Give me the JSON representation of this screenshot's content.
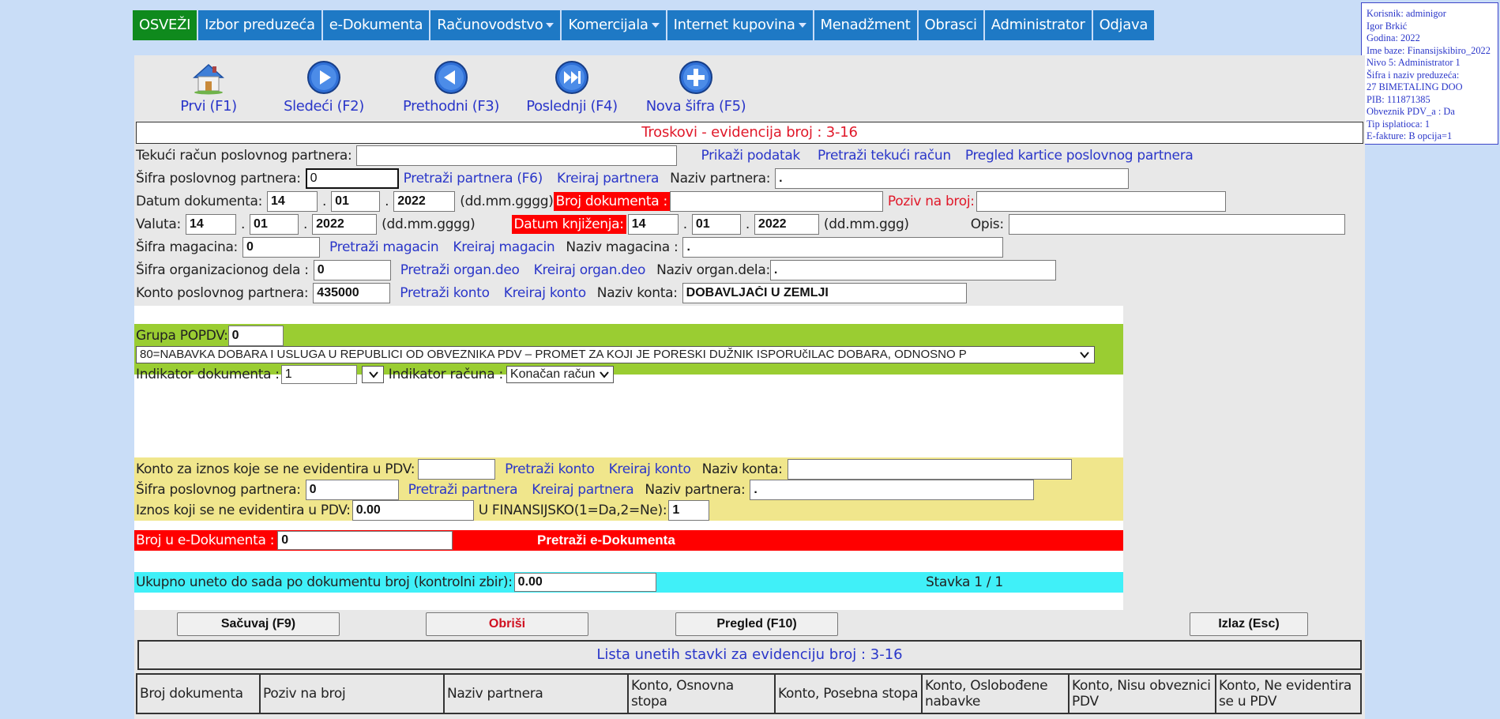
{
  "nav": {
    "items": [
      {
        "label": "OSVEŽI",
        "dropdown": false
      },
      {
        "label": "Izbor preduzeća",
        "dropdown": false
      },
      {
        "label": "e-Dokumenta",
        "dropdown": false
      },
      {
        "label": "Računovodstvo",
        "dropdown": true
      },
      {
        "label": "Komercijala",
        "dropdown": true
      },
      {
        "label": "Internet kupovina",
        "dropdown": true
      },
      {
        "label": "Menadžment",
        "dropdown": false
      },
      {
        "label": "Obrasci",
        "dropdown": false
      },
      {
        "label": "Administrator",
        "dropdown": false
      },
      {
        "label": "Odjava",
        "dropdown": false
      }
    ]
  },
  "user_info": {
    "lines": [
      "Korisnik: adminigor",
      "Igor Brkić",
      "Godina: 2022",
      "Ime baze: Finansijskibiro_2022",
      "Nivo 5: Administrator 1",
      "Šifra i naziv preduzeća:",
      "27 BIMETALING DOO",
      "PIB: 111871385",
      "Obveznik PDV_a : Da",
      "Tip isplatioca: 1",
      "E-fakture: B opcija=1"
    ]
  },
  "toolbar": {
    "first": "Prvi (F1)",
    "next": "Sledeći (F2)",
    "prev": "Prethodni (F3)",
    "last": "Poslednji (F4)",
    "new": "Nova šifra (F5)"
  },
  "colors": {
    "nav_blue": "#1e79c5",
    "nav_green": "#0f8a1d",
    "title_red": "#e0192a",
    "link_blue": "#2a36c9"
  },
  "doc_title": "Troskovi - evidencija broj : 3-16",
  "form": {
    "tekuci_racun_label": "Tekući račun poslovnog partnera:",
    "tekuci_racun_value": "",
    "prikazi_podatak": "Prikaži podatak",
    "pretrazi_tekuci": "Pretraži tekući račun",
    "pregled_kartice": "Pregled kartice poslovnog partnera",
    "sifra_partnera_label": "Šifra poslovnog partnera:",
    "sifra_partnera_value": "0",
    "pretrazi_partnera": "Pretraži partnera (F6)",
    "kreiraj_partnera": "Kreiraj partnera",
    "naziv_partnera_label": "Naziv partnera:",
    "naziv_partnera_value": ".",
    "datum_dok_label": "Datum dokumenta:",
    "datum_dok_d": "14",
    "datum_dok_m": "01",
    "datum_dok_y": "2022",
    "fmt_long": "(dd.mm.gggg)",
    "fmt_short": "(dd.mm.ggg)",
    "dot": ".",
    "broj_dok_label": "Broj dokumenta :",
    "broj_dok_value": "",
    "poziv_label": "Poziv na broj:",
    "poziv_value": "",
    "valuta_label": "Valuta:",
    "valuta_d": "14",
    "valuta_m": "01",
    "valuta_y": "2022",
    "datum_knj_label": "Datum knjiženja:",
    "knj_d": "14",
    "knj_m": "01",
    "knj_y": "2022",
    "opis_label": "Opis:",
    "opis_value": "",
    "sifra_magacina_label": "Šifra magacina:",
    "sifra_magacina_value": "0",
    "pretrazi_magacin": "Pretraži magacin",
    "kreiraj_magacin": "Kreiraj magacin",
    "naziv_magacina_label": "Naziv magacina :",
    "naziv_magacina_value": ".",
    "sifra_org_label": "Šifra organizacionog dela :",
    "sifra_org_value": "0",
    "pretrazi_org": "Pretraži organ.deo",
    "kreiraj_org": "Kreiraj organ.deo",
    "naziv_org_label": "Naziv organ.dela:",
    "naziv_org_value": ".",
    "konto_partnera_label": "Konto poslovnog partnera:",
    "konto_partnera_value": "435000",
    "pretrazi_konto": "Pretraži konto",
    "kreiraj_konto": "Kreiraj konto",
    "naziv_konta_label": "Naziv konta:",
    "naziv_konta_value": "DOBAVLJAČI U ZEMLJI"
  },
  "popdv": {
    "grupa_label": "Grupa POPDV:",
    "grupa_value": "0",
    "select_value": "80=NABAVKA DOBARA I USLUGA U REPUBLICI OD OBVEZNIKA PDV – PROMET ZA KOJI JE PORESKI DUŽNIK ISPORUčILAC DOBARA, ODNOSNO P",
    "indikator_dok_label": "Indikator dokumenta :",
    "indikator_dok_value": "1",
    "indikator_racuna_label": "Indikator računa :",
    "indikator_racuna_value": "Konačan račun"
  },
  "nepdv": {
    "konto_label": "Konto za iznos koje se ne evidentira u PDV:",
    "konto_value": "",
    "pretrazi_konto": "Pretraži konto",
    "kreiraj_konto": "Kreiraj konto",
    "naziv_konta_label": "Naziv konta:",
    "naziv_konta_value": "",
    "sifra_label": "Šifra poslovnog partnera:",
    "sifra_value": "0",
    "pretrazi_partnera": "Pretraži partnera",
    "kreiraj_partnera": "Kreiraj partnera",
    "naziv_partnera_label": "Naziv partnera:",
    "naziv_partnera_value": ".",
    "iznos_label": "Iznos koji se ne evidentira u PDV:",
    "iznos_value": "0.00",
    "finansijsko_label": "U FINANSIJSKO(1=Da,2=Ne):",
    "finansijsko_value": "1"
  },
  "edok": {
    "label": "Broj u e-Dokumenta :",
    "value": "0",
    "search": "Pretraži e-Dokumenta"
  },
  "total": {
    "label": "Ukupno uneto do sada po dokumentu broj (kontrolni zbir):",
    "value": "0.00",
    "stavka": "Stavka 1 / 1"
  },
  "actions": {
    "save": "Sačuvaj (F9)",
    "delete": "Obriši",
    "preview": "Pregled (F10)",
    "exit": "Izlaz (Esc)"
  },
  "list": {
    "title": "Lista unetih stavki za evidenciju broj : 3-16",
    "columns": [
      "Broj dokumenta",
      "Poziv na broj",
      "Naziv partnera",
      "Konto, Osnovna stopa",
      "Konto, Posebna stopa",
      "Konto, Oslobođene nabavke",
      "Konto, Nisu obveznici PDV",
      "Konto, Ne evidentira se u PDV"
    ]
  }
}
